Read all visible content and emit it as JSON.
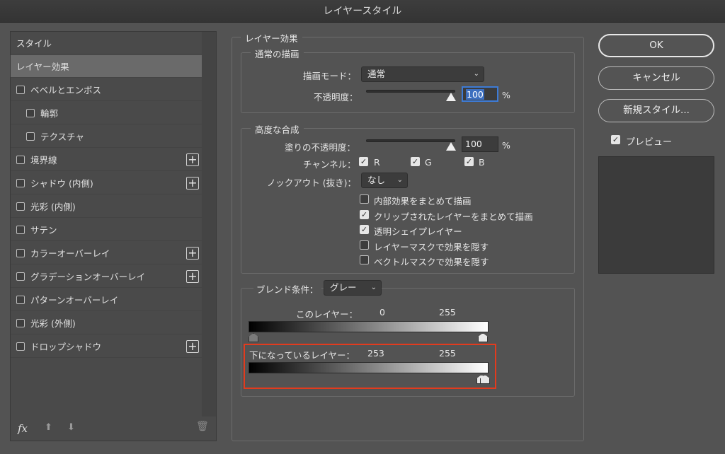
{
  "window": {
    "title": "レイヤースタイル"
  },
  "sidebar": {
    "items": [
      {
        "label": "スタイル",
        "checkbox": false,
        "indent": 0,
        "plus": false
      },
      {
        "label": "レイヤー効果",
        "checkbox": false,
        "indent": 0,
        "plus": false,
        "selected": true
      },
      {
        "label": "ベベルとエンボス",
        "checkbox": true,
        "indent": 0,
        "plus": false
      },
      {
        "label": "輪郭",
        "checkbox": true,
        "indent": 1,
        "plus": false
      },
      {
        "label": "テクスチャ",
        "checkbox": true,
        "indent": 1,
        "plus": false
      },
      {
        "label": "境界線",
        "checkbox": true,
        "indent": 0,
        "plus": true
      },
      {
        "label": "シャドウ (内側)",
        "checkbox": true,
        "indent": 0,
        "plus": true
      },
      {
        "label": "光彩 (内側)",
        "checkbox": true,
        "indent": 0,
        "plus": false
      },
      {
        "label": "サテン",
        "checkbox": true,
        "indent": 0,
        "plus": false
      },
      {
        "label": "カラーオーバーレイ",
        "checkbox": true,
        "indent": 0,
        "plus": true
      },
      {
        "label": "グラデーションオーバーレイ",
        "checkbox": true,
        "indent": 0,
        "plus": true
      },
      {
        "label": "パターンオーバーレイ",
        "checkbox": true,
        "indent": 0,
        "plus": false
      },
      {
        "label": "光彩 (外側)",
        "checkbox": true,
        "indent": 0,
        "plus": false
      },
      {
        "label": "ドロップシャドウ",
        "checkbox": true,
        "indent": 0,
        "plus": true
      }
    ],
    "fx_label": "fx"
  },
  "effects": {
    "title": "レイヤー効果",
    "normal": {
      "title": "通常の描画",
      "blend_mode_label": "描画モード：",
      "blend_mode_value": "通常",
      "opacity_label": "不透明度：",
      "opacity_value": "100",
      "percent": "%",
      "opacity_fraction": 1.0
    },
    "advanced": {
      "title": "高度な合成",
      "fill_opacity_label": "塗りの不透明度：",
      "fill_opacity_value": "100",
      "percent": "%",
      "fill_fraction": 1.0,
      "channels_label": "チャンネル：",
      "channel_r": "R",
      "channel_g": "G",
      "channel_b": "B",
      "knockout_label": "ノックアウト (抜き)：",
      "knockout_value": "なし",
      "options": [
        {
          "label": "内部効果をまとめて描画",
          "checked": false
        },
        {
          "label": "クリップされたレイヤーをまとめて描画",
          "checked": true
        },
        {
          "label": "透明シェイプレイヤー",
          "checked": true
        },
        {
          "label": "レイヤーマスクで効果を隠す",
          "checked": false
        },
        {
          "label": "ベクトルマスクで効果を隠す",
          "checked": false
        }
      ]
    },
    "blend_if": {
      "label": "ブレンド条件：",
      "value": "グレー",
      "this_layer_label": "このレイヤー：",
      "this_layer_min": "0",
      "this_layer_max": "255",
      "underlying_label": "下になっているレイヤー：",
      "underlying_min": "253",
      "underlying_max": "255"
    }
  },
  "buttons": {
    "ok": "OK",
    "cancel": "キャンセル",
    "new_style": "新規スタイル...",
    "preview_label": "プレビュー"
  },
  "colors": {
    "highlight": "#e23b1e",
    "selection": "#3d6fbf"
  }
}
